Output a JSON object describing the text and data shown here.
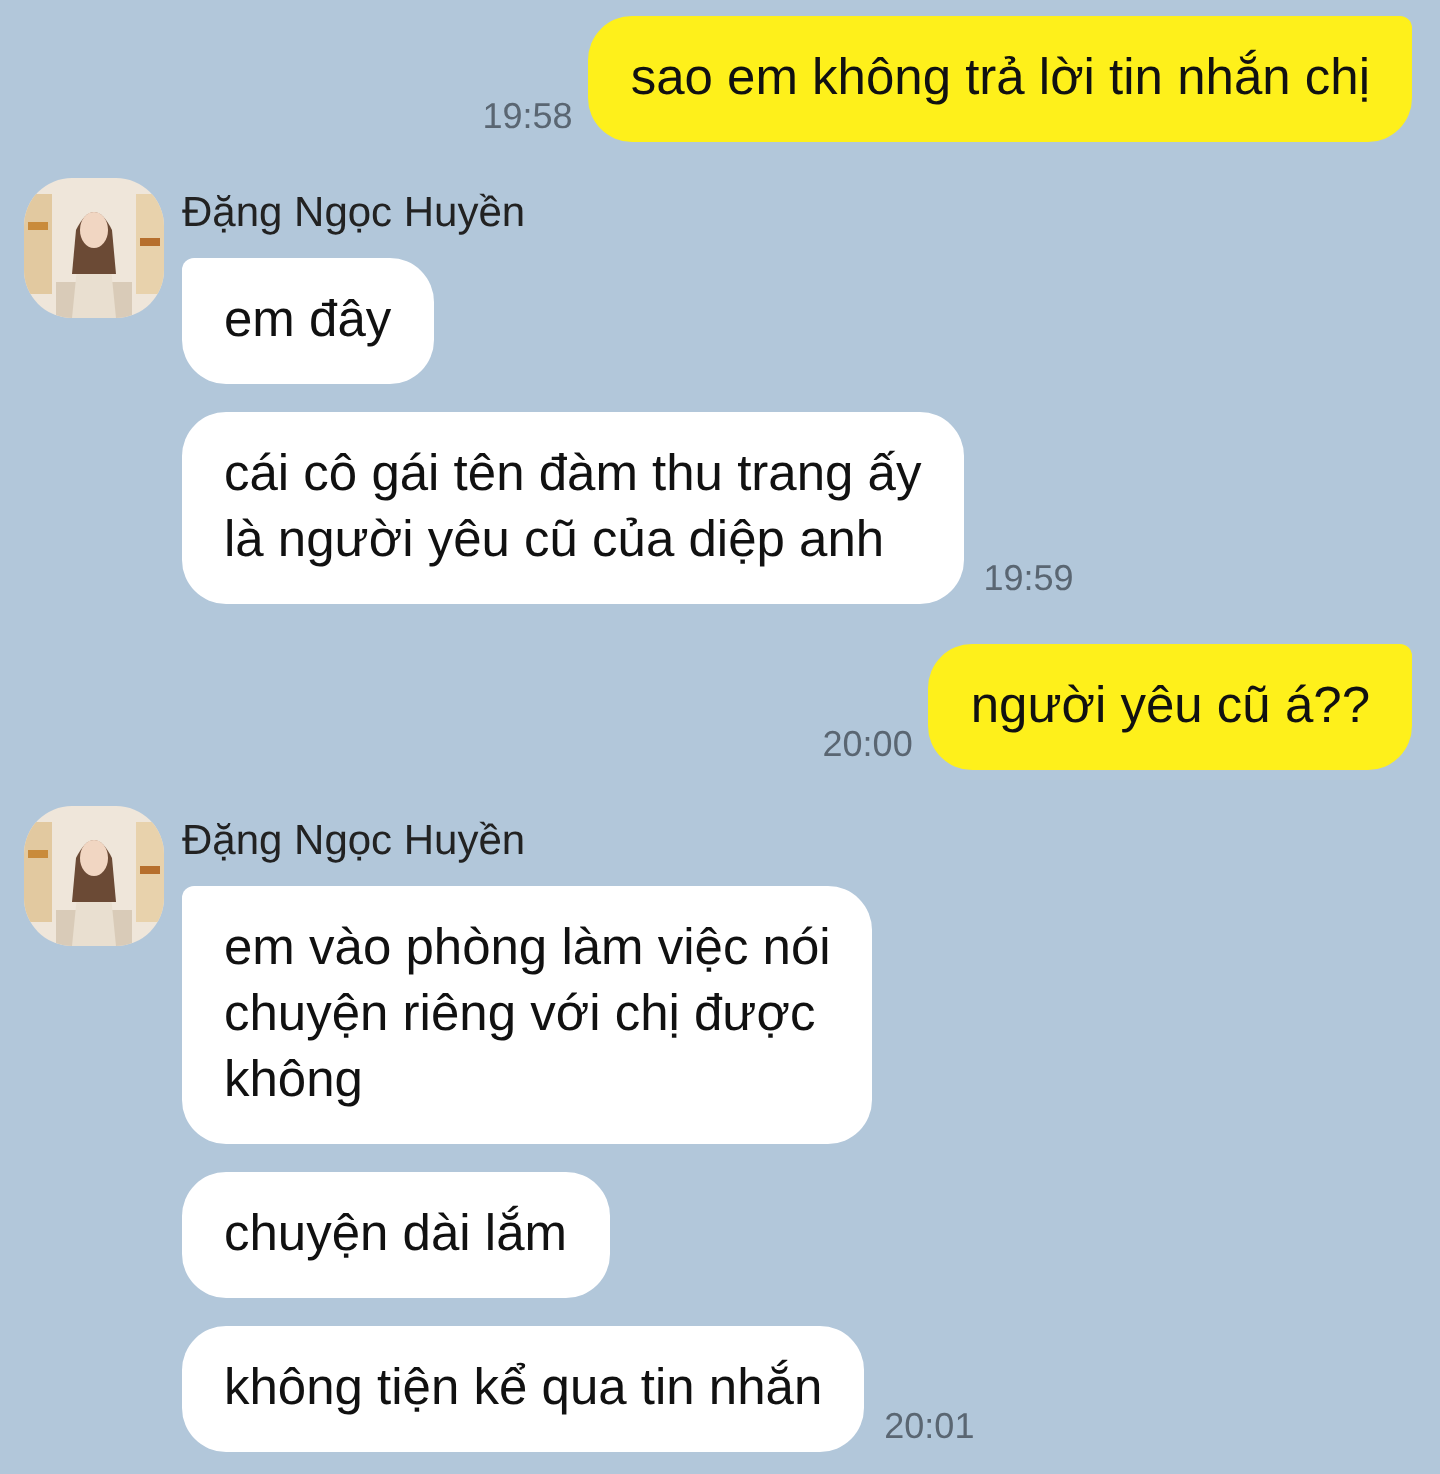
{
  "messages": [
    {
      "kind": "sent",
      "bubbles": [
        "sao em không trả lời tin nhắn chị"
      ],
      "time": "19:58"
    },
    {
      "kind": "received",
      "sender": "Đặng Ngọc Huyền",
      "avatar": {
        "kind": "picture"
      },
      "bubbles": [
        "em đây",
        "cái cô gái tên đàm thu trang ấy\nlà người yêu cũ của diệp anh"
      ],
      "time": "19:59"
    },
    {
      "kind": "sent",
      "bubbles": [
        "người yêu cũ á??"
      ],
      "time": "20:00"
    },
    {
      "kind": "received",
      "sender": "Đặng Ngọc Huyền",
      "avatar": {
        "kind": "picture"
      },
      "bubbles": [
        "em vào phòng làm việc nói\nchuyện riêng với chị được\nkhông",
        "chuyện dài lắm",
        "không tiện kể qua tin nhắn"
      ],
      "time": "20:01"
    }
  ]
}
